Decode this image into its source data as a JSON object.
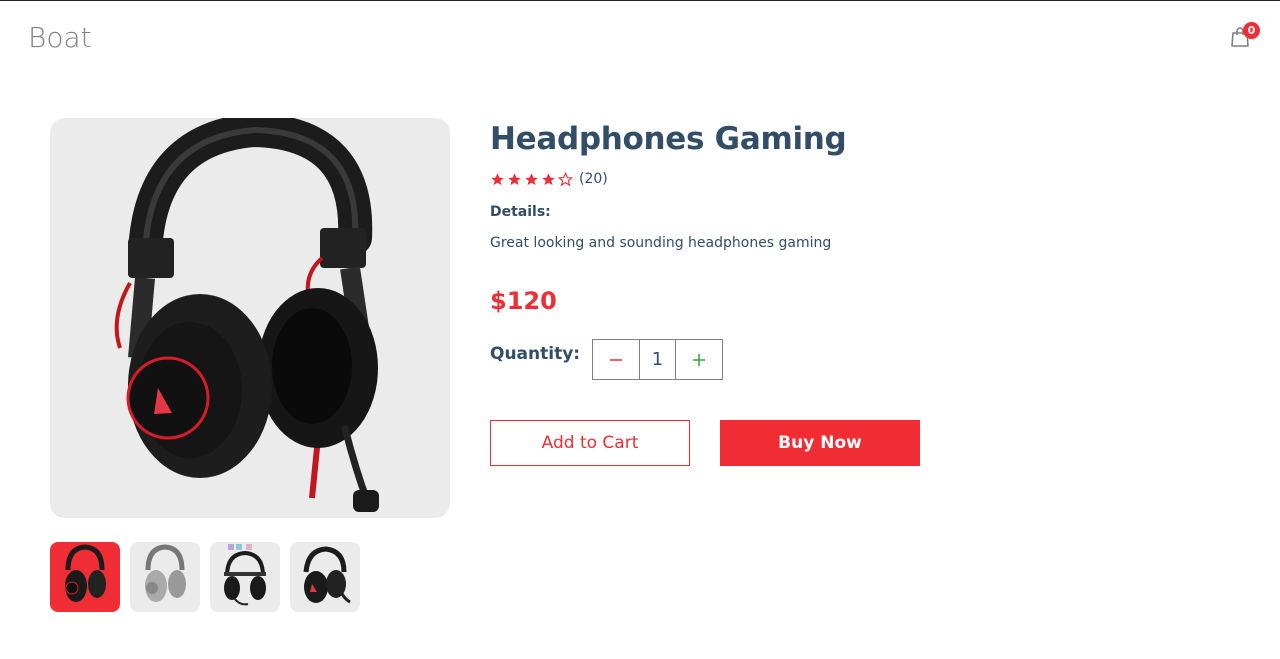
{
  "navbar": {
    "logo": "Boat",
    "cart_count": "0",
    "cart_icon": "shopping-bag-icon"
  },
  "product": {
    "title": "Headphones Gaming",
    "rating": 4,
    "rating_max": 5,
    "review_count": "(20)",
    "details_label": "Details:",
    "details_text": "Great looking and sounding headphones gaming",
    "price": "$120",
    "image_icon": "headphones-image"
  },
  "thumbnails": [
    {
      "name": "headphones-thumbnail-1",
      "selected": true
    },
    {
      "name": "headphones-thumbnail-2",
      "selected": false
    },
    {
      "name": "headphones-thumbnail-3",
      "selected": false
    },
    {
      "name": "headphones-thumbnail-4",
      "selected": false
    }
  ],
  "quantity": {
    "label": "Quantity:",
    "value": "1",
    "minus_icon": "minus-icon",
    "plus_icon": "plus-icon"
  },
  "actions": {
    "add_to_cart": "Add to Cart",
    "buy_now": "Buy Now"
  },
  "colors": {
    "accent": "#f02d34",
    "text": "#324d67",
    "image_bg": "#ebebeb",
    "plus": "#31a831"
  }
}
